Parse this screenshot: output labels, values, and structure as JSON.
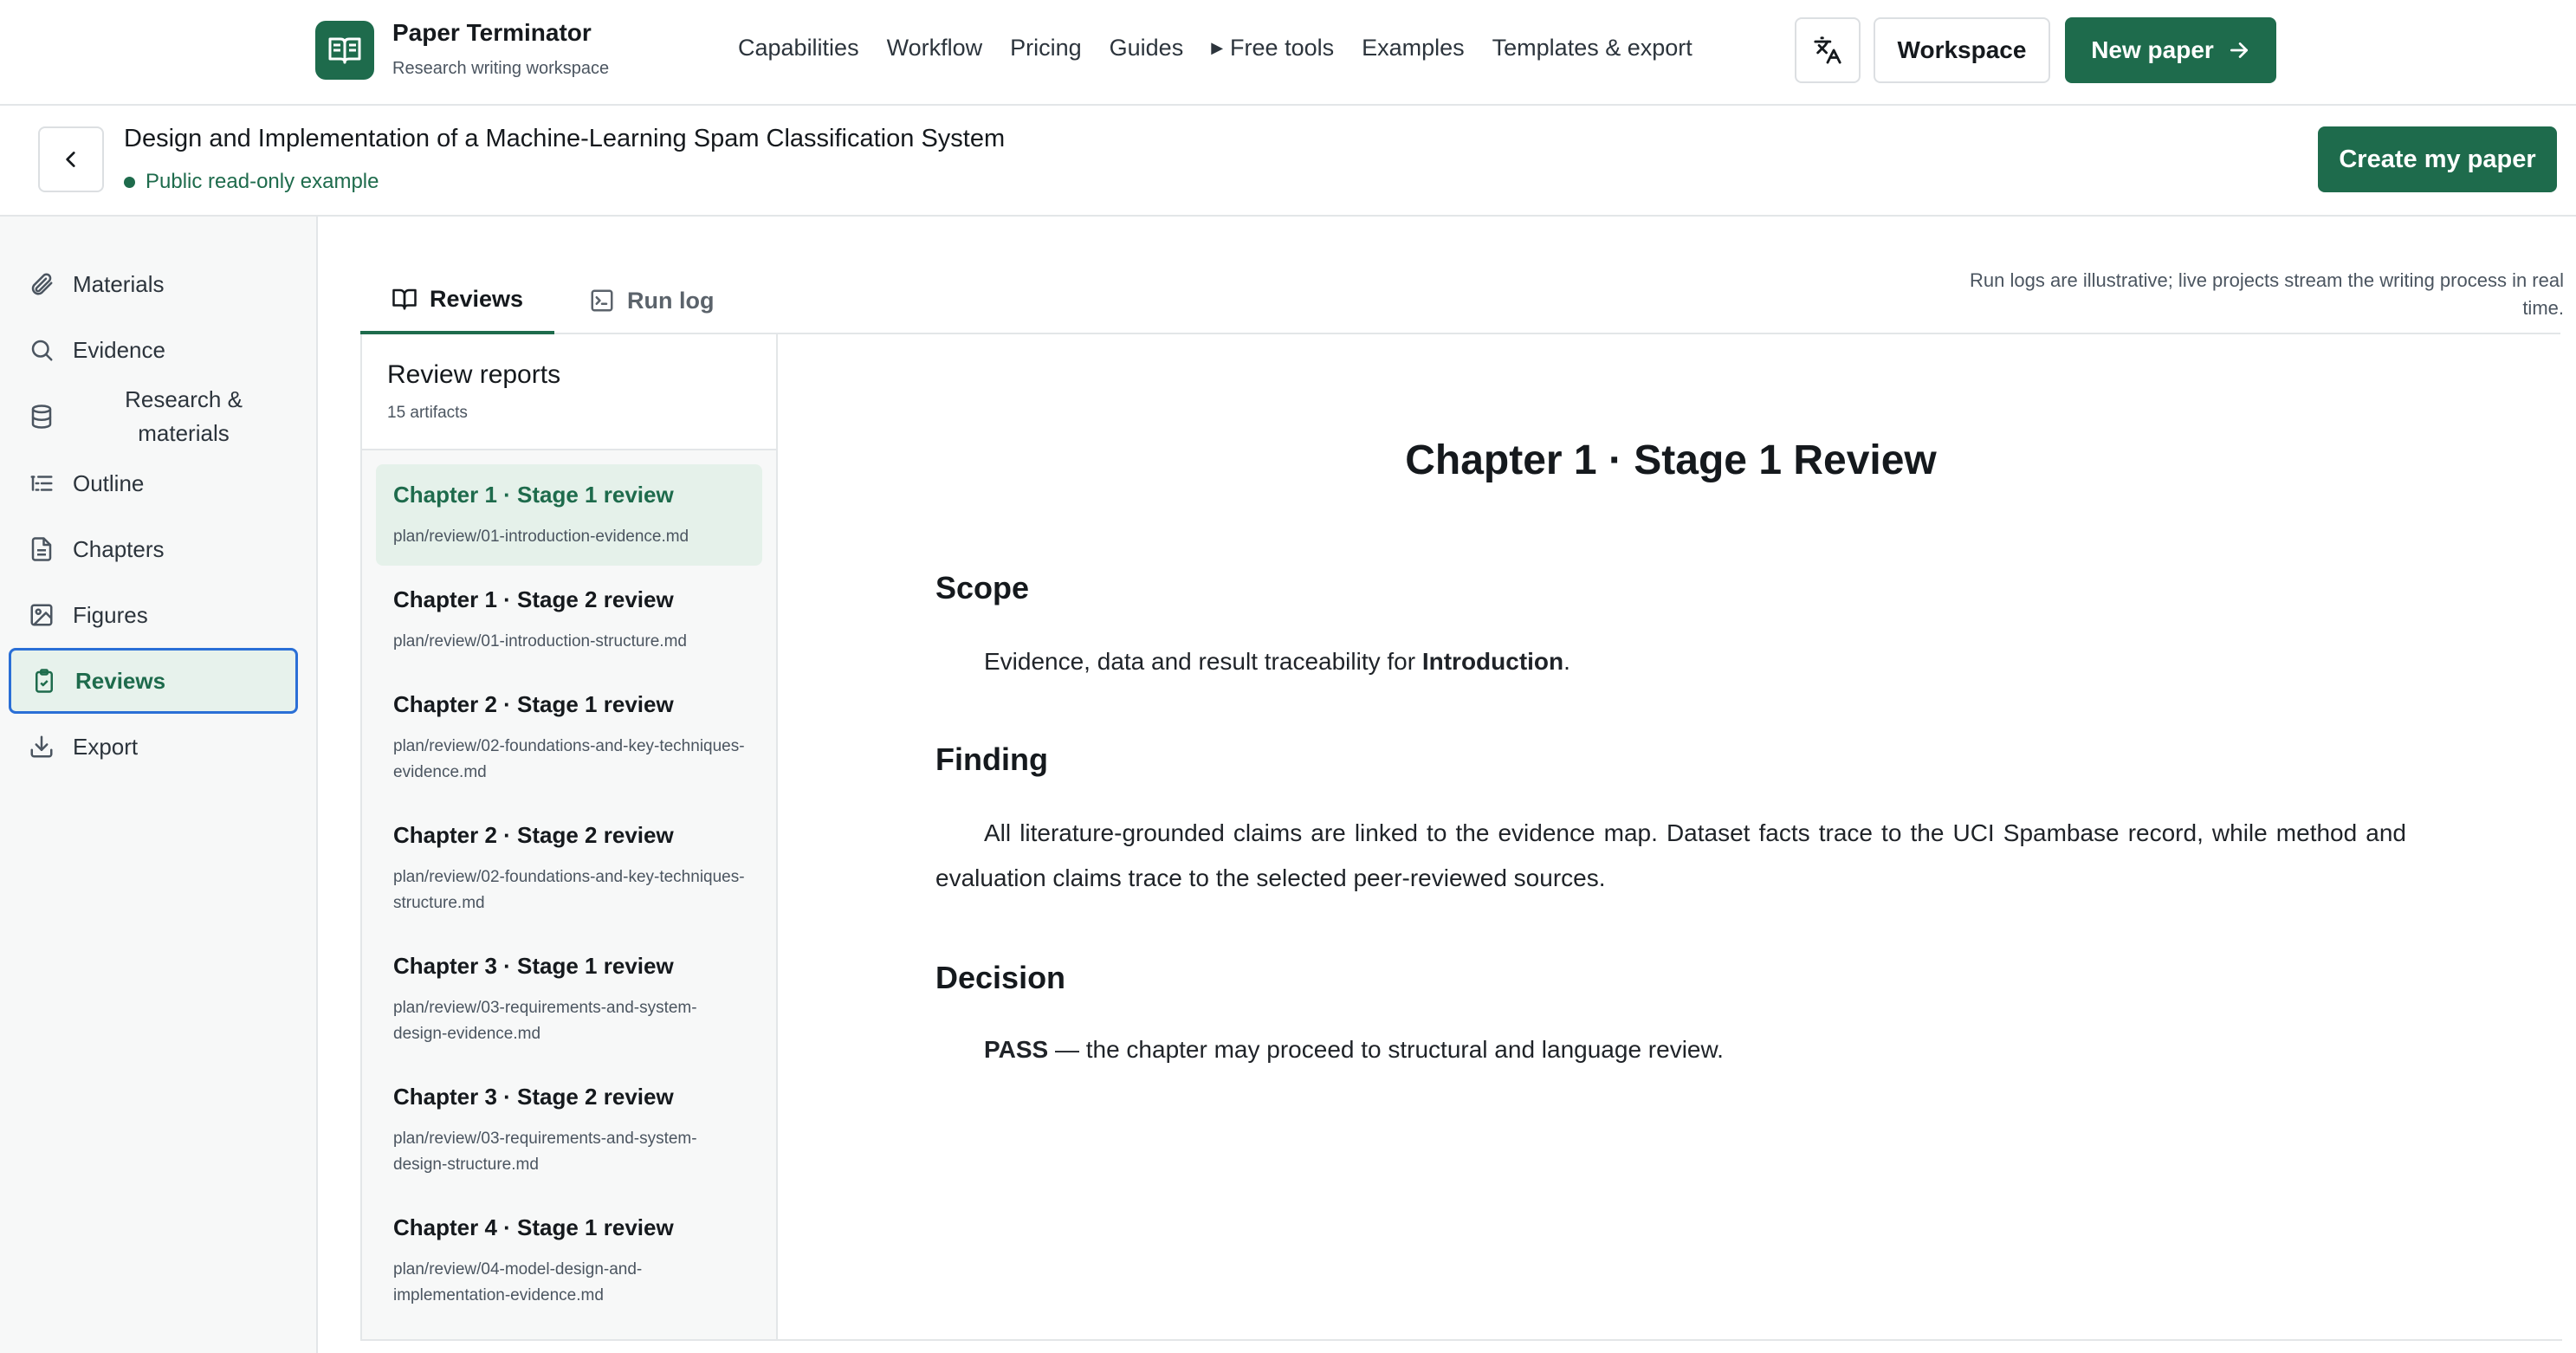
{
  "brand": {
    "name": "Paper Terminator",
    "subtitle": "Research writing workspace"
  },
  "nav": {
    "links": [
      "Capabilities",
      "Workflow",
      "Pricing",
      "Guides",
      "Free tools",
      "Examples",
      "Templates & export"
    ],
    "workspace_label": "Workspace",
    "new_paper_label": "New paper"
  },
  "header": {
    "title": "Design and Implementation of a Machine-Learning Spam Classification System",
    "status": "Public read-only example",
    "create_label": "Create my paper"
  },
  "sidebar": {
    "items": [
      {
        "label": "Materials",
        "icon": "paperclip-icon"
      },
      {
        "label": "Evidence",
        "icon": "search-icon"
      },
      {
        "label": "Research & materials",
        "icon": "database-icon"
      },
      {
        "label": "Outline",
        "icon": "list-icon"
      },
      {
        "label": "Chapters",
        "icon": "file-text-icon"
      },
      {
        "label": "Figures",
        "icon": "image-icon"
      },
      {
        "label": "Reviews",
        "icon": "clipboard-check-icon",
        "active": true
      },
      {
        "label": "Export",
        "icon": "download-icon"
      }
    ]
  },
  "tabs": [
    {
      "label": "Reviews",
      "icon": "book-open-icon",
      "active": true
    },
    {
      "label": "Run log",
      "icon": "terminal-icon"
    }
  ],
  "tab_note": "Run logs are illustrative; live projects stream the writing process in real time.",
  "reports": {
    "title": "Review reports",
    "count": "15 artifacts",
    "items": [
      {
        "title": "Chapter 1 · Stage 1 review",
        "path": "plan/review/01-introduction-evidence.md",
        "active": true
      },
      {
        "title": "Chapter 1 · Stage 2 review",
        "path": "plan/review/01-introduction-structure.md"
      },
      {
        "title": "Chapter 2 · Stage 1 review",
        "path": "plan/review/02-foundations-and-key-techniques-evidence.md"
      },
      {
        "title": "Chapter 2 · Stage 2 review",
        "path": "plan/review/02-foundations-and-key-techniques-structure.md"
      },
      {
        "title": "Chapter 3 · Stage 1 review",
        "path": "plan/review/03-requirements-and-system-design-evidence.md"
      },
      {
        "title": "Chapter 3 · Stage 2 review",
        "path": "plan/review/03-requirements-and-system-design-structure.md"
      },
      {
        "title": "Chapter 4 · Stage 1 review",
        "path": "plan/review/04-model-design-and-implementation-evidence.md"
      }
    ]
  },
  "document": {
    "title": "Chapter 1 · Stage 1 Review",
    "scope_heading": "Scope",
    "scope_text": "Evidence, data and result traceability for",
    "scope_bold": "Introduction",
    "scope_end": ".",
    "finding_heading": "Finding",
    "finding_text": "All literature-grounded claims are linked to the evidence map. Dataset facts trace to the UCI Spambase record, while method and evaluation claims trace to the selected peer-reviewed sources.",
    "decision_heading": "Decision",
    "decision_bold": "PASS",
    "decision_text": " — the chapter may proceed to structural and language review."
  },
  "colors": {
    "accent": "#1e6b4c",
    "active_bg": "#e5f1ea",
    "focus_ring": "#2a6fd6"
  }
}
